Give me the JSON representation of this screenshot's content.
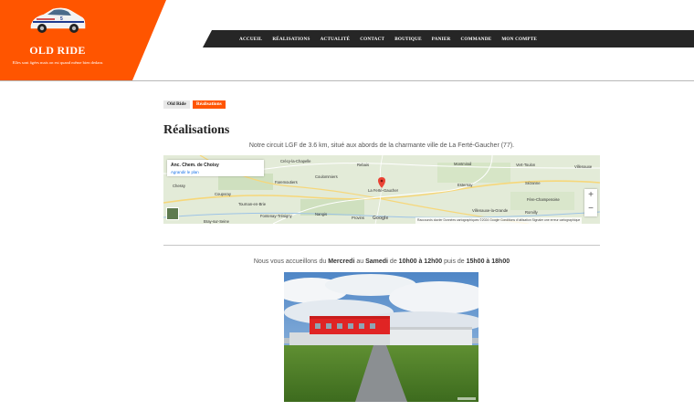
{
  "site": {
    "title": "OLD RIDE",
    "tagline": "Elles sont âgées mais on est quand même bien dedans"
  },
  "nav": {
    "items": [
      "ACCUEIL",
      "RÉALISATIONS",
      "ACTUALITÉ",
      "CONTACT",
      "BOUTIQUE",
      "PANIER",
      "COMMANDE",
      "MON COMPTE"
    ]
  },
  "breadcrumb": {
    "home": "Old Ride",
    "current": "Réalisations"
  },
  "page": {
    "title": "Réalisations",
    "intro": "Notre circuit LGF de 3.6 km, situé aux abords de la charmante ville de La Ferté-Gaucher (77).",
    "hours_prefix": "Nous vous accueillons du ",
    "day_from": "Mercredi",
    "hours_mid1": " au ",
    "day_to": "Samedi",
    "hours_mid2": " de ",
    "morning": "10h00 à 12h00",
    "hours_mid3": " puis de ",
    "afternoon": "15h00 à 18h00"
  },
  "map": {
    "card_title": "Anc. Chem. de Choisy",
    "card_link": "Agrandir le plan",
    "zoom_in": "+",
    "zoom_out": "−",
    "brand": "Google",
    "footer": "Raccourcis clavier   Données cartographiques ©2024 Google   Conditions d'utilisation   Signaler une erreur cartographique",
    "places": {
      "p1": "Coulommiers",
      "p2": "Coupvray",
      "p3": "Rebais",
      "p4": "Montmirail",
      "p5": "Vert-Toulon",
      "p6": "Villenauxe",
      "p7": "Crécy-la-Chapelle",
      "p8": "Faremoutiers",
      "p9": "La Ferté-Gaucher",
      "p10": "Esternay",
      "p11": "Sézanne",
      "p12": "Fère-Champenoise",
      "p13": "Nangis",
      "p14": "Provins",
      "p15": "Fontenay-Trésigny",
      "p16": "Tournan-en-Brie",
      "p17": "Villenauxe-la-Grande",
      "p18": "Bray-sur-Seine",
      "p19": "Romilly",
      "p20": "Chessy"
    }
  },
  "colors": {
    "accent": "#ff5500",
    "nav_bg": "#262626"
  }
}
